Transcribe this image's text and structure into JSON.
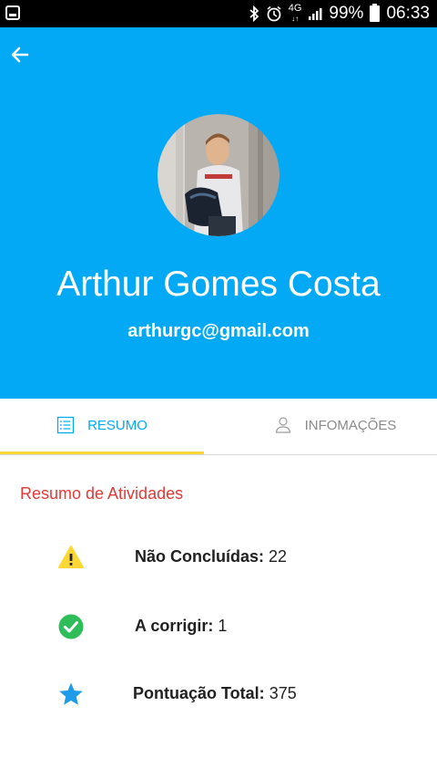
{
  "status_bar": {
    "battery": "99%",
    "time": "06:33",
    "network": "4G",
    "icons": [
      "bluetooth-icon",
      "alarm-icon",
      "signal-icon",
      "battery-icon"
    ]
  },
  "header": {
    "background_color": "#03a9f4",
    "back_icon": "arrow-left-icon",
    "name": "Arthur Gomes Costa",
    "email": "arthurgc@gmail.com"
  },
  "tabs": [
    {
      "label": "RESUMO",
      "icon": "list-icon",
      "active": true
    },
    {
      "label": "INFOMAÇÕES",
      "icon": "person-icon",
      "active": false
    }
  ],
  "colors": {
    "accent": "#03a9f4",
    "tab_indicator": "#fdd835",
    "section_title": "#e53935",
    "warning": "#fdd835",
    "success": "#2ebd59",
    "star": "#1e9be9"
  },
  "summary": {
    "title": "Resumo de Atividades",
    "items": [
      {
        "icon": "warning-icon",
        "label": "Não Concluídas:",
        "value": "22"
      },
      {
        "icon": "check-circle-icon",
        "label": "A corrigir:",
        "value": "1"
      },
      {
        "icon": "star-icon",
        "label": "Pontuação Total:",
        "value": "375"
      }
    ]
  }
}
